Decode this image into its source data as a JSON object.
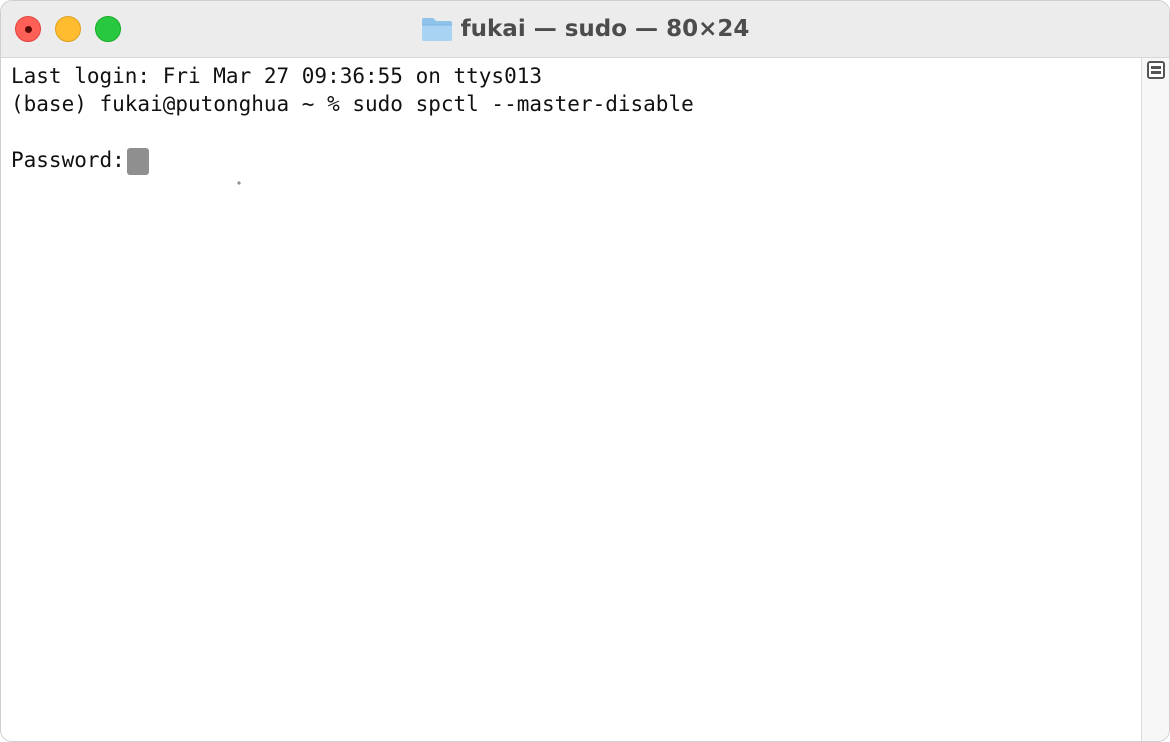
{
  "window": {
    "title": "fukai — sudo — 80×24",
    "folder_icon": "folder-icon",
    "colors": {
      "close": "#fe5f57",
      "minimize": "#febc2e",
      "zoom": "#28c840"
    }
  },
  "terminal": {
    "lines": [
      "Last login: Fri Mar 27 09:36:55 on ttys013",
      "(base) fukai@putonghua ~ % sudo spctl --master-disable",
      "",
      "Password:"
    ],
    "cursor_icon": "key-icon"
  },
  "scrollbar": {
    "icon": "split-pane-icon"
  }
}
